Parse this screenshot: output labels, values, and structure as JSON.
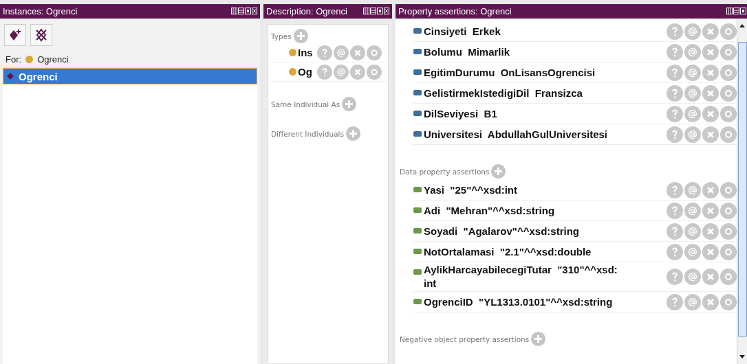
{
  "instances": {
    "title": "Instances: Ogrenci",
    "for_label": "For:",
    "for_class": "Ogrenci",
    "individuals": [
      {
        "label": "Ogrenci",
        "selected": true
      }
    ]
  },
  "description": {
    "title": "Description: Ogrenci",
    "sections": [
      {
        "label": "Types",
        "items": [
          {
            "label": "Ins"
          },
          {
            "label": "Og"
          }
        ]
      },
      {
        "label": "Same Individual As"
      },
      {
        "label": "Different Individuals"
      }
    ]
  },
  "property_assertions": {
    "title": "Property assertions: Ogrenci",
    "items": [
      {
        "kind": "object",
        "text": "Cinsiyeti  Erkek"
      },
      {
        "kind": "object",
        "text": "Bolumu  Mimarlik"
      },
      {
        "kind": "object",
        "text": "EgitimDurumu  OnLisansOgrencisi"
      },
      {
        "kind": "object",
        "text": "GelistirmekIstedigiDil  Fransizca"
      },
      {
        "kind": "object",
        "text": "DilSeviyesi  B1"
      },
      {
        "kind": "object",
        "text": "Universitesi  AbdullahGulUniversitesi"
      }
    ],
    "sections": [
      {
        "label": "Data property assertions",
        "items": [
          {
            "kind": "data",
            "text": "Yasi  \"25\"^^xsd:int"
          },
          {
            "kind": "data",
            "text": "Adi  \"Mehran\"^^xsd:string"
          },
          {
            "kind": "data",
            "text": "Soyadi  \"Agalarov\"^^xsd:string"
          },
          {
            "kind": "data",
            "text": "NotOrtalamasi  \"2.1\"^^xsd:double"
          },
          {
            "kind": "data",
            "text": "AylikHarcayabilecegiTutar  \"310\"^^xsd:\nint"
          },
          {
            "kind": "data",
            "text": "OgrenciID  \"YL1313.0101\"^^xsd:string"
          }
        ]
      },
      {
        "label": "Negative object property assertions"
      }
    ]
  }
}
